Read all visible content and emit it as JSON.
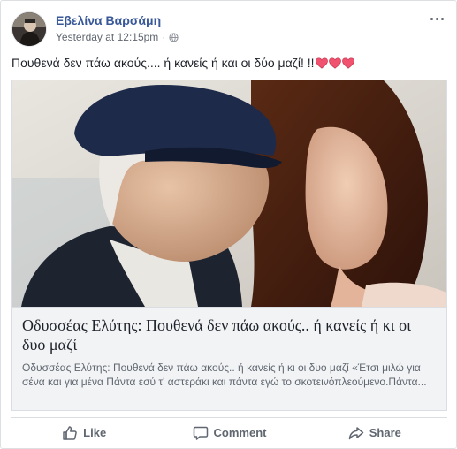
{
  "post": {
    "author": "Εβελίνα Βαρσάμη",
    "timestamp": "Yesterday at 12:15pm",
    "separator": "·",
    "privacy_icon": "globe-icon",
    "text": "Πουθενά δεν πάω ακούς.... ή κανείς ή και οι δύο μαζί! !!",
    "emojis": [
      "heart-icon",
      "heart-icon",
      "heart-icon"
    ],
    "more_icon": "more-options-icon"
  },
  "link_preview": {
    "title": "Οδυσσέας Ελύτης: Πουθενά δεν πάω ακούς.. ή κανείς ή κι οι δυο μαζί",
    "description": "Οδυσσέας Ελύτης: Πουθενά δεν πάω ακούς.. ή κανείς ή κι οι δυο μαζί «Έτσι μιλώ για σένα και για μένα Πάντα εσύ τ' αστεράκι και πάντα εγώ το σκοτεινόπλεούμενο.Πάντα..."
  },
  "actions": {
    "like": "Like",
    "comment": "Comment",
    "share": "Share"
  },
  "colors": {
    "author": "#385898",
    "heart": "#f0526f",
    "card_bg": "#f2f3f5",
    "action_text": "#606770"
  }
}
